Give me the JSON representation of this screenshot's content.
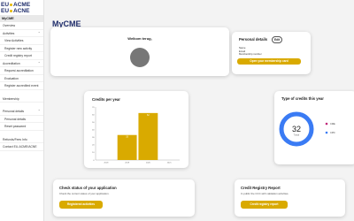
{
  "logo": {
    "line1": "EU",
    "line1b": "ACME",
    "line2": "EU",
    "line2b": "ACNE"
  },
  "sidebar": {
    "header": "MyCME",
    "items": [
      {
        "label": "Overview",
        "sub": false,
        "group": false
      },
      {
        "label": "Activities",
        "sub": false,
        "group": true
      },
      {
        "label": "View Activities",
        "sub": true,
        "group": false
      },
      {
        "label": "Register new activity",
        "sub": true,
        "group": false
      },
      {
        "label": "Credit registry report",
        "sub": true,
        "group": false
      },
      {
        "label": "Accreditation",
        "sub": false,
        "group": true
      },
      {
        "label": "Request accreditation",
        "sub": true,
        "group": false
      },
      {
        "label": "Evaluation",
        "sub": true,
        "group": false
      },
      {
        "label": "Register accredited event",
        "sub": true,
        "group": false
      },
      {
        "label": "Membership",
        "sub": false,
        "group": false,
        "gap": true
      },
      {
        "label": "Personal details",
        "sub": false,
        "group": true,
        "gap": true
      },
      {
        "label": "Personal details",
        "sub": true,
        "group": false
      },
      {
        "label": "Reset password",
        "sub": true,
        "group": false
      },
      {
        "label": "Refunds/Fees Info",
        "sub": false,
        "group": false,
        "gap": true
      },
      {
        "label": "Contact EU-ACME/ACNE",
        "sub": false,
        "group": false
      }
    ]
  },
  "page_title": "MyCME",
  "welcome": {
    "title": "Welkom terug,"
  },
  "personal": {
    "title": "Personal details",
    "edit_label": "Edit",
    "name_label": "Name",
    "email_label": "Email",
    "membership_label": "Membership number",
    "button": "Open your membership card"
  },
  "credits_year": {
    "title": "Credits per year",
    "chart_data": {
      "type": "bar",
      "categories": [
        "2018",
        "2019",
        "2020",
        "2021"
      ],
      "values": [
        0,
        33,
        62,
        0
      ],
      "ylim": [
        0,
        70
      ],
      "yticks": [
        0,
        10,
        20,
        30,
        40,
        50,
        60,
        70
      ],
      "bar_labels": [
        "",
        "33",
        "62",
        ""
      ],
      "bar_color": "#d9aa00",
      "grid": false
    }
  },
  "credits_type": {
    "title": "Type of credits this year",
    "chart_data": {
      "type": "pie",
      "center_value": "32",
      "center_label": "Totaal",
      "slices": [
        {
          "name": "CME",
          "value": 0,
          "color": "#c0287a"
        },
        {
          "name": "CPD",
          "value": 32,
          "color": "#3a7bf4"
        }
      ]
    }
  },
  "status_app": {
    "title": "Check status of your application",
    "subtitle": "Check the current status of your application.",
    "button": "Registered activities"
  },
  "credit_report": {
    "title": "Credit Registry Report",
    "subtitle": "In public the CCC with validation activities.",
    "button": "Credit registry report"
  }
}
